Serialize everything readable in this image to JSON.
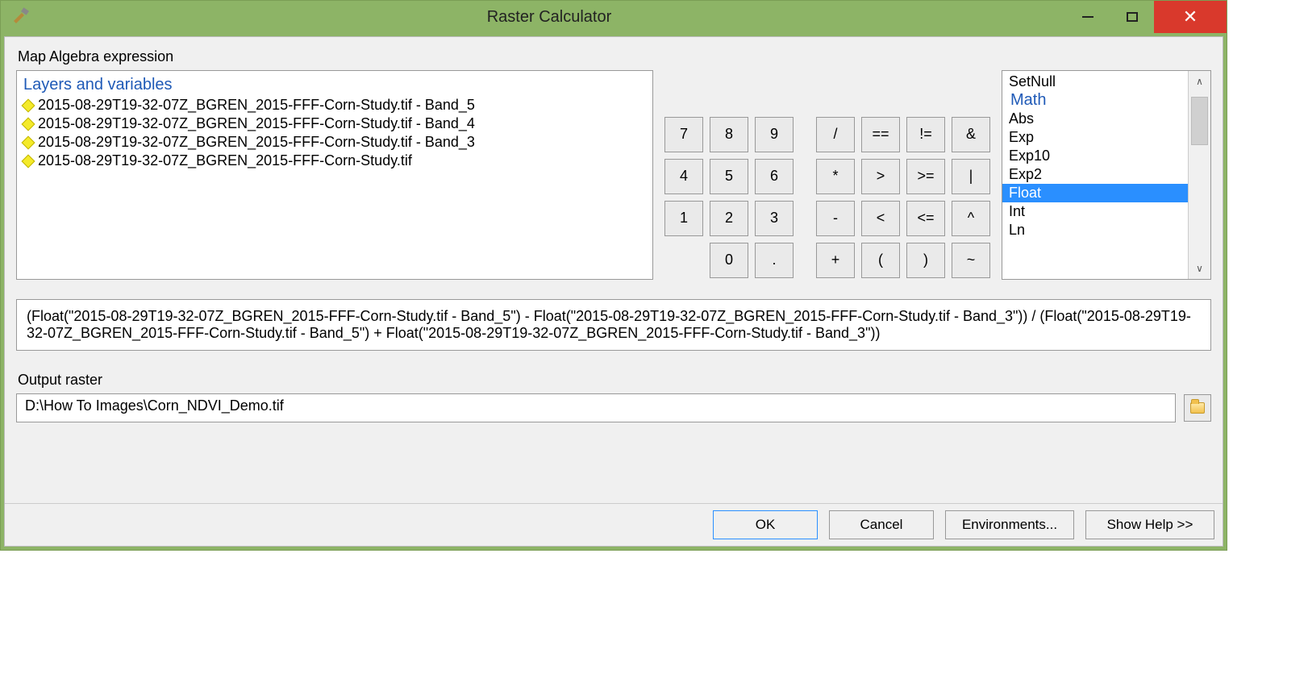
{
  "window": {
    "title": "Raster Calculator"
  },
  "section": {
    "map_algebra_label": "Map Algebra expression",
    "layers_header": "Layers and variables",
    "output_label": "Output raster"
  },
  "layers": [
    "2015-08-29T19-32-07Z_BGREN_2015-FFF-Corn-Study.tif - Band_5",
    "2015-08-29T19-32-07Z_BGREN_2015-FFF-Corn-Study.tif - Band_4",
    "2015-08-29T19-32-07Z_BGREN_2015-FFF-Corn-Study.tif - Band_3",
    "2015-08-29T19-32-07Z_BGREN_2015-FFF-Corn-Study.tif"
  ],
  "keypad": {
    "r1": [
      "7",
      "8",
      "9",
      "/",
      "==",
      "!=",
      "&"
    ],
    "r2": [
      "4",
      "5",
      "6",
      "*",
      ">",
      ">=",
      "|"
    ],
    "r3": [
      "1",
      "2",
      "3",
      "-",
      "<",
      "<=",
      "^"
    ],
    "r4": [
      "0",
      ".",
      "+",
      "(",
      ")",
      "~"
    ]
  },
  "functions": {
    "header": "Math",
    "top_item": "SetNull",
    "items": [
      "Abs",
      "Exp",
      "Exp10",
      "Exp2",
      "Float",
      "Int",
      "Ln"
    ],
    "selected": "Float"
  },
  "expression": "(Float(\"2015-08-29T19-32-07Z_BGREN_2015-FFF-Corn-Study.tif - Band_5\") - Float(\"2015-08-29T19-32-07Z_BGREN_2015-FFF-Corn-Study.tif - Band_3\")) / (Float(\"2015-08-29T19-32-07Z_BGREN_2015-FFF-Corn-Study.tif - Band_5\") + Float(\"2015-08-29T19-32-07Z_BGREN_2015-FFF-Corn-Study.tif - Band_3\"))",
  "output_raster": "D:\\How To Images\\Corn_NDVI_Demo.tif",
  "buttons": {
    "ok": "OK",
    "cancel": "Cancel",
    "env": "Environments...",
    "help": "Show Help >>"
  }
}
